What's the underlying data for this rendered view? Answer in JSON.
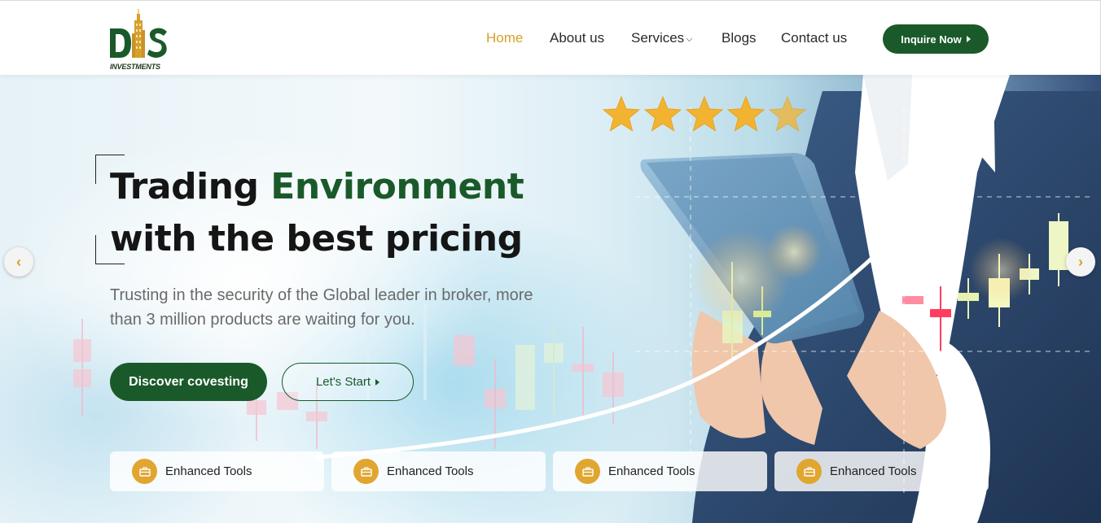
{
  "header": {
    "logo_text": "DIS",
    "logo_subtext": "INVESTMENTS",
    "nav": [
      {
        "label": "Home",
        "active": true
      },
      {
        "label": "About us",
        "active": false
      },
      {
        "label": "Services",
        "active": false,
        "has_dropdown": true
      },
      {
        "label": "Blogs",
        "active": false
      },
      {
        "label": "Contact us",
        "active": false
      }
    ],
    "cta_label": "Inquire Now"
  },
  "hero": {
    "headline_part1": "Trading ",
    "headline_highlight": "Environment",
    "headline_line2": "with the best pricing",
    "subtext": "Trusting in the security of the Global leader in broker, more than 3 million products are waiting for you.",
    "primary_button": "Discover covesting",
    "secondary_button": "Let's Start",
    "prev_arrow": "‹",
    "next_arrow": "›",
    "rating_stars": 5,
    "features": [
      {
        "label": "Enhanced Tools",
        "icon": "briefcase-icon"
      },
      {
        "label": "Enhanced Tools",
        "icon": "briefcase-icon"
      },
      {
        "label": "Enhanced Tools",
        "icon": "briefcase-icon"
      },
      {
        "label": "Enhanced Tools",
        "icon": "briefcase-icon"
      }
    ]
  },
  "colors": {
    "brand_green": "#1a5a2a",
    "accent_gold": "#d6a02a",
    "icon_gold": "#e0a630"
  }
}
